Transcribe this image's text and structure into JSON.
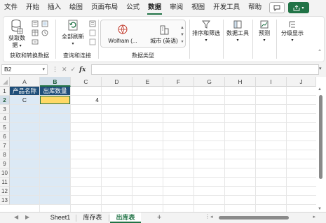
{
  "menu": {
    "items": [
      "文件",
      "开始",
      "插入",
      "绘图",
      "页面布局",
      "公式",
      "数据",
      "审阅",
      "视图",
      "开发工具",
      "帮助"
    ],
    "active_index": 6
  },
  "ribbon": {
    "get_data_label_1": "获取数",
    "get_data_label_2": "据",
    "refresh_all_label_1": "全部刷新",
    "datatype_wolfram": "Wolfram (...",
    "datatype_city": "城市 (英语)",
    "sort_filter_label": "排序和筛选",
    "data_tools_label": "数据工具",
    "forecast_label": "预测",
    "outline_label": "分级显示",
    "group_get_transform": "获取和转换数据",
    "group_queries": "查询和连接",
    "group_datatypes": "数据类型"
  },
  "formula_bar": {
    "name_box": "B2",
    "fx_symbol": "fx",
    "formula_value": ""
  },
  "grid": {
    "columns": [
      "A",
      "B",
      "C",
      "D",
      "E",
      "F",
      "G",
      "H",
      "I",
      "J"
    ],
    "rows": [
      "1",
      "2",
      "3",
      "4",
      "5",
      "6",
      "7",
      "8",
      "9",
      "10",
      "11",
      "12",
      "13"
    ],
    "selected_column": "B",
    "selected_row": "2",
    "cells": {
      "A1": "产品名称",
      "B1": "出库数量",
      "A2": "C",
      "B2": "",
      "C2": "4"
    },
    "colors": {
      "header_fill": "#1f4e79",
      "data_fill": "#dce9f5",
      "selected_fill": "#ffd966",
      "accent": "#217346"
    }
  },
  "sheets": {
    "tabs": [
      "Sheet1",
      "库存表",
      "出库表"
    ],
    "active_index": 2,
    "add_symbol": "+"
  }
}
